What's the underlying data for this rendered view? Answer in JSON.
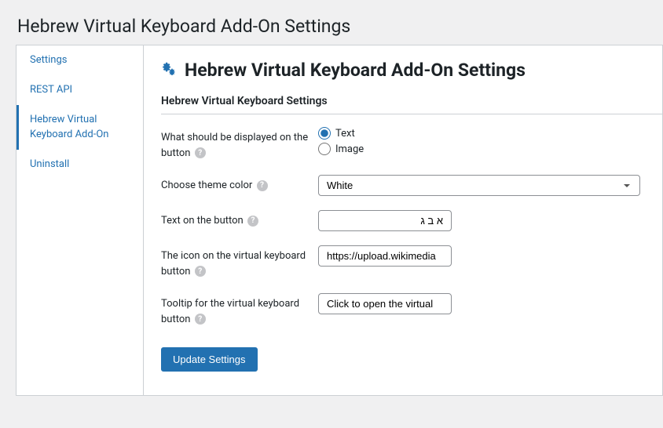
{
  "page_heading": "Hebrew Virtual Keyboard Add-On Settings",
  "sidebar": {
    "items": [
      {
        "label": "Settings"
      },
      {
        "label": "REST API"
      },
      {
        "label": "Hebrew Virtual Keyboard Add-On"
      },
      {
        "label": "Uninstall"
      }
    ]
  },
  "content": {
    "title": "Hebrew Virtual Keyboard Add-On Settings",
    "section_heading": "Hebrew Virtual Keyboard Settings",
    "fields": {
      "display_mode": {
        "label": "What should be displayed on the button",
        "option_text": "Text",
        "option_image": "Image"
      },
      "theme_color": {
        "label": "Choose theme color",
        "value": "White"
      },
      "button_text": {
        "label": "Text on the button",
        "value": "א ב ג"
      },
      "button_icon": {
        "label": "The icon on the virtual keyboard button",
        "value": "https://upload.wikimedia"
      },
      "tooltip": {
        "label": "Tooltip for the virtual keyboard button",
        "value": "Click to open the virtual"
      }
    },
    "submit_label": "Update Settings"
  },
  "help_glyph": "?"
}
